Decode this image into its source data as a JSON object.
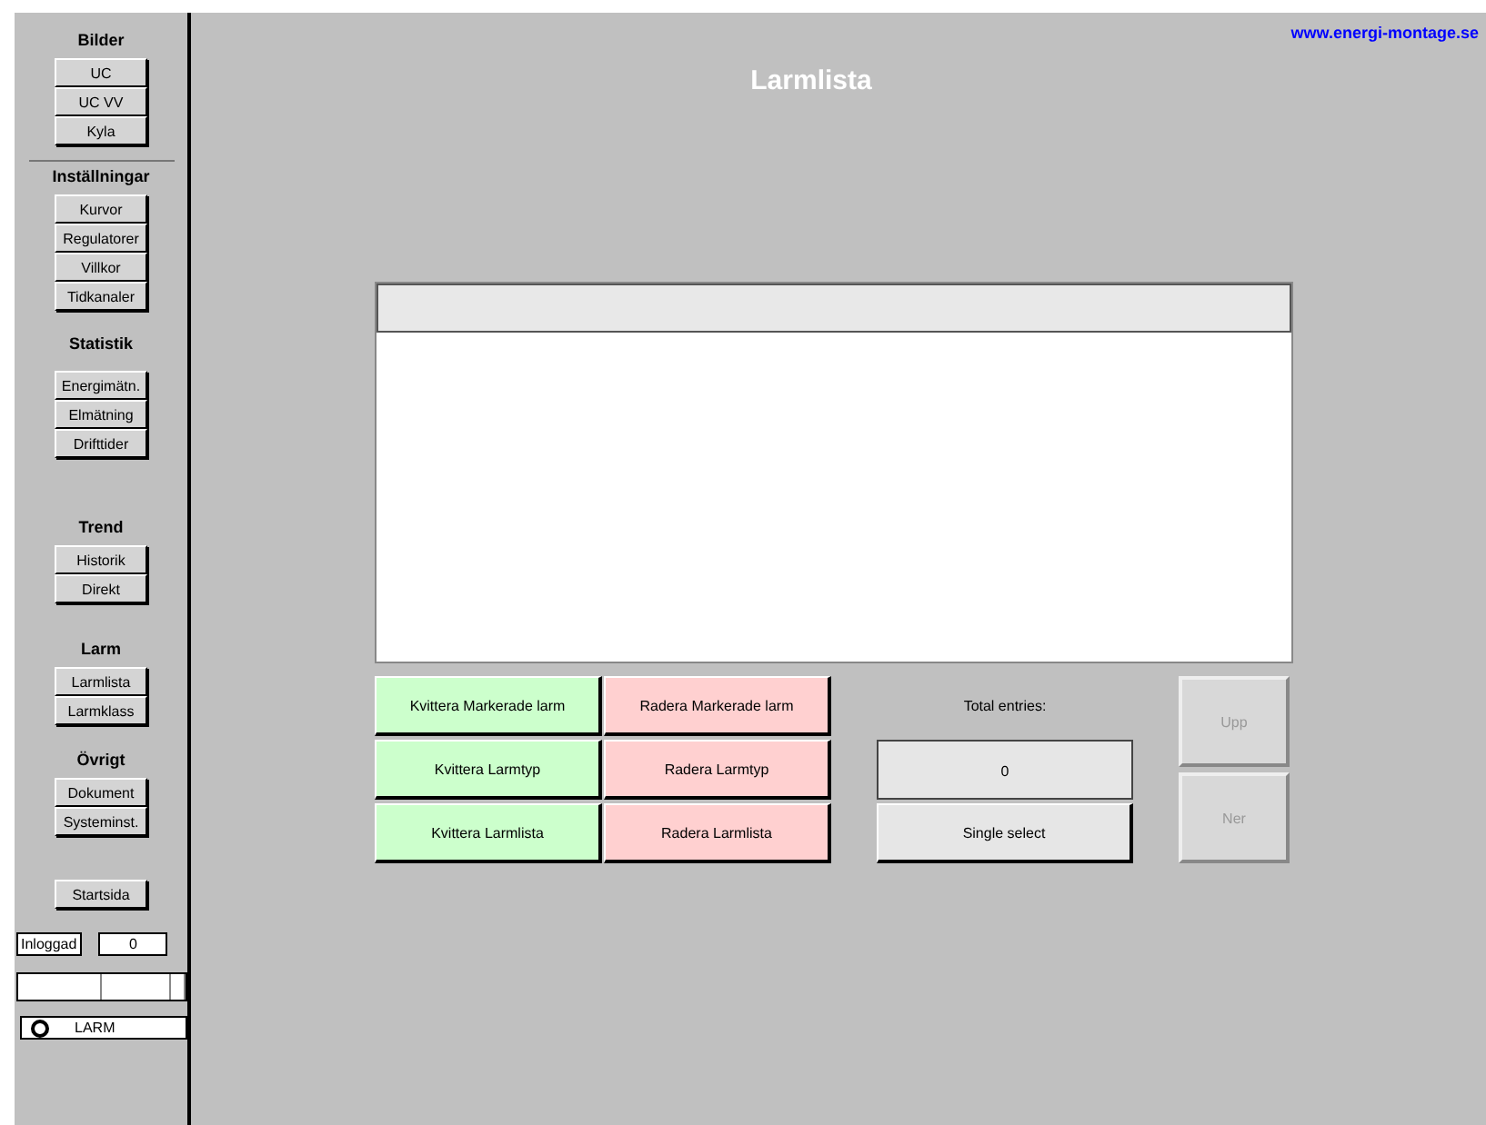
{
  "sidebar": {
    "sections": [
      {
        "heading": "Bilder",
        "items": [
          "UC",
          "UC VV",
          "Kyla"
        ],
        "divider_after": true
      },
      {
        "heading": "Inställningar",
        "items": [
          "Kurvor",
          "Regulatorer",
          "Villkor",
          "Tidkanaler"
        ],
        "divider_after": false
      },
      {
        "heading": "Statistik",
        "items": [
          "Energimätn.",
          "Elmätning",
          "Drifttider"
        ],
        "divider_after": false
      },
      {
        "heading": "Trend",
        "items": [
          "Historik",
          "Direkt"
        ],
        "divider_after": false
      },
      {
        "heading": "Larm",
        "items": [
          "Larmlista",
          "Larmklass"
        ],
        "divider_after": false
      },
      {
        "heading": "Övrigt",
        "items": [
          "Dokument",
          "Systeminst."
        ],
        "divider_after": false
      }
    ],
    "home_button": "Startsida",
    "login": {
      "label": "Inloggad",
      "value": "0"
    },
    "alarm_indicator": {
      "label": "LARM",
      "active": false
    }
  },
  "website": "www.energi-montage.se",
  "title": "Larmlista",
  "actions": [
    {
      "label": "Kvittera Markerade larm",
      "kind": "ack"
    },
    {
      "label": "Radera Markerade larm",
      "kind": "delete"
    },
    {
      "label": "Kvittera Larmtyp",
      "kind": "ack"
    },
    {
      "label": "Radera Larmtyp",
      "kind": "delete"
    },
    {
      "label": "Kvittera Larmlista",
      "kind": "ack"
    },
    {
      "label": "Radera Larmlista",
      "kind": "delete"
    }
  ],
  "total_entries": {
    "label": "Total entries:",
    "value": "0"
  },
  "select_mode": "Single select",
  "nav_buttons": [
    {
      "label": "Upp",
      "disabled": true
    },
    {
      "label": "Ner",
      "disabled": true
    }
  ]
}
